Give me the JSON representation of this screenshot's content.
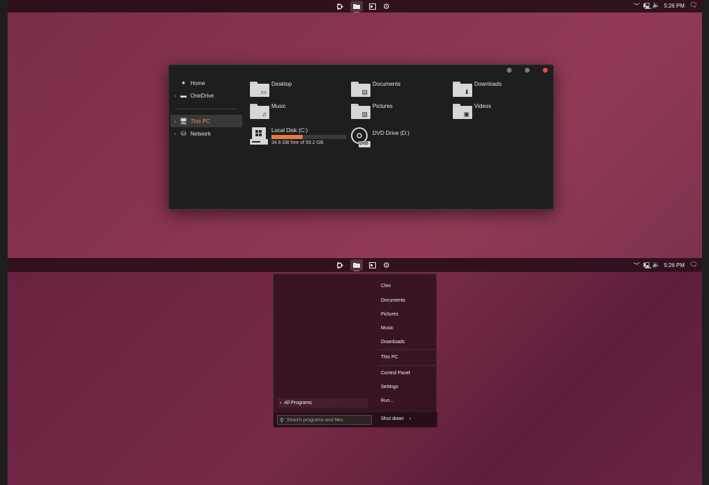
{
  "clock": "5:26 PM",
  "explorer": {
    "nav": {
      "home": "Home",
      "onedrive": "OneDrive",
      "this_pc": "This PC",
      "network": "Network"
    },
    "folders": {
      "desktop": "Desktop",
      "documents": "Documents",
      "downloads": "Downloads",
      "music": "Music",
      "pictures": "Pictures",
      "videos": "Videos"
    },
    "drives": {
      "local_name": "Local Disk (C:)",
      "local_free": "34.6 GB free of 59.2 GB",
      "local_used_fraction": 0.42,
      "dvd_name": "DVD Drive (D:)",
      "dvd_badge": "DVD"
    }
  },
  "start_menu": {
    "items": {
      "user": "Cleo",
      "documents": "Documents",
      "pictures": "Pictures",
      "music": "Music",
      "downloads": "Downloads",
      "this_pc": "This PC",
      "control_panel": "Control Panel",
      "settings": "Settings",
      "run": "Run..."
    },
    "all_programs": "All Programs",
    "search_placeholder": "Search programs and files",
    "shutdown": "Shut down"
  },
  "colors": {
    "accent": "#e8793e",
    "close_button": "#e8502a"
  }
}
